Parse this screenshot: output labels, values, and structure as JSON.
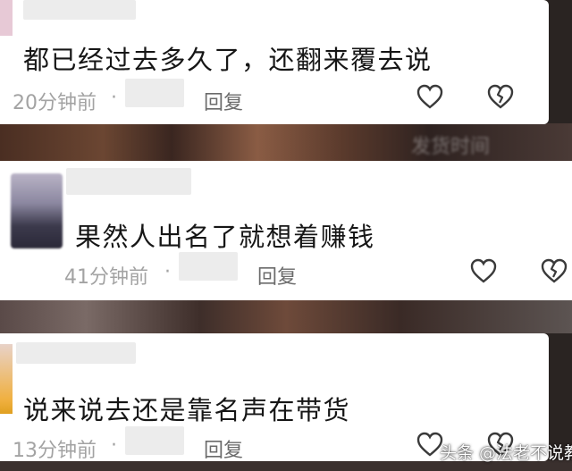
{
  "comments": [
    {
      "text": "都已经过去多久了，还翻来覆去说",
      "time": "20分钟前",
      "separator": "·",
      "reply": "回复"
    },
    {
      "text": "果然人出名了就想着赚钱",
      "time": "41分钟前",
      "separator": "·",
      "reply": "回复"
    },
    {
      "text": "说来说去还是靠名声在带货",
      "time": "13分钟前",
      "separator": "·",
      "reply": "回复"
    }
  ],
  "watermark": "头条 @法老不说教",
  "icons": {
    "like": "heart-icon",
    "dislike": "broken-heart-icon"
  },
  "colors": {
    "text": "#161616",
    "meta": "#a3a3a3",
    "reply": "#6b6b6b",
    "icon": "#3a3a3a"
  }
}
